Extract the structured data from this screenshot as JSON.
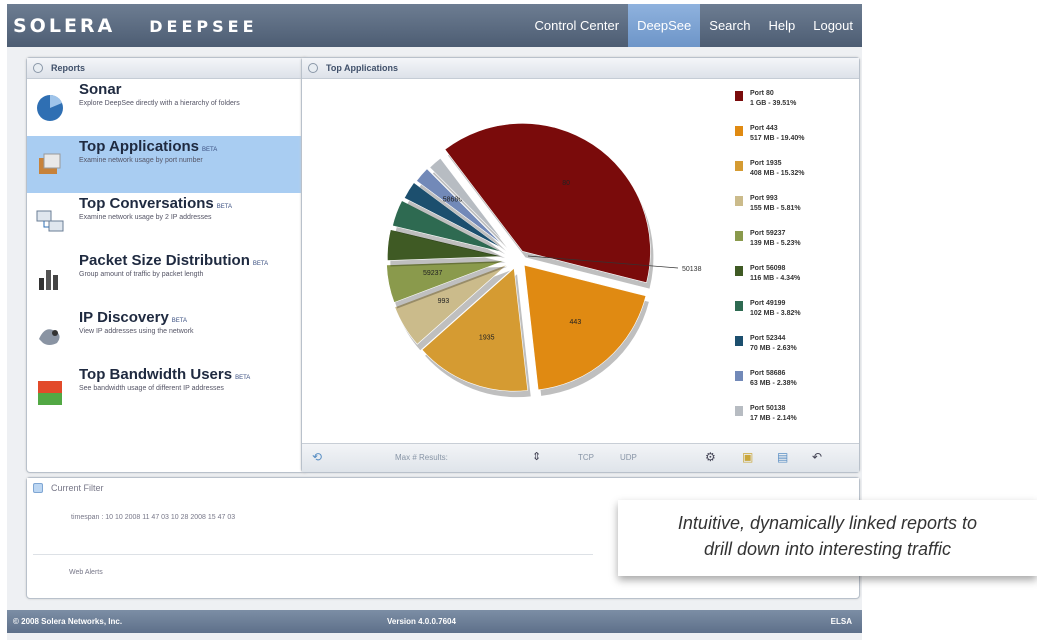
{
  "header": {
    "logo": "SOLERA",
    "product": "DEEPSEE",
    "nav": [
      "Control Center",
      "DeepSee",
      "Search",
      "Help",
      "Logout"
    ],
    "active_nav": "DeepSee"
  },
  "reports_panel": {
    "title": "Reports",
    "items": [
      {
        "title": "Sonar",
        "badge": "",
        "desc": "Explore DeepSee directly with a hierarchy of folders"
      },
      {
        "title": "Top Applications",
        "badge": "BETA",
        "desc": "Examine network usage by port number"
      },
      {
        "title": "Top Conversations",
        "badge": "BETA",
        "desc": "Examine network usage by 2 IP addresses"
      },
      {
        "title": "Packet Size Distribution",
        "badge": "BETA",
        "desc": "Group amount of traffic by packet length"
      },
      {
        "title": "IP Discovery",
        "badge": "BETA",
        "desc": "View IP addresses using the network"
      },
      {
        "title": "Top Bandwidth Users",
        "badge": "BETA",
        "desc": "See bandwidth usage of different IP addresses"
      }
    ],
    "selected_index": 1
  },
  "top_apps_panel": {
    "title": "Top Applications",
    "toolbar": {
      "max_results": "Max # Results:",
      "tcp": "TCP",
      "udp": "UDP"
    },
    "callout_label": "50138"
  },
  "chart_data": {
    "type": "pie",
    "legend_placement": "right",
    "slices": [
      {
        "name": "Port 80",
        "label": "1 GB - 39.51%",
        "value": 39.51,
        "color": "#7a0b0b",
        "pie_label": "80"
      },
      {
        "name": "Port 443",
        "label": "517 MB - 19.40%",
        "value": 19.4,
        "color": "#e08a12",
        "pie_label": "443"
      },
      {
        "name": "Port 1935",
        "label": "408 MB - 15.32%",
        "value": 15.32,
        "color": "#d59b32",
        "pie_label": "1935"
      },
      {
        "name": "Port 993",
        "label": "155 MB - 5.81%",
        "value": 5.81,
        "color": "#cbbb8b",
        "pie_label": "993"
      },
      {
        "name": "Port 59237",
        "label": "139 MB - 5.23%",
        "value": 5.23,
        "color": "#8a9a4c",
        "pie_label": "59237"
      },
      {
        "name": "Port 56098",
        "label": "116 MB - 4.34%",
        "value": 4.34,
        "color": "#3f5a24",
        "pie_label": ""
      },
      {
        "name": "Port 49199",
        "label": "102 MB - 3.82%",
        "value": 3.82,
        "color": "#2e6a51",
        "pie_label": ""
      },
      {
        "name": "Port 52344",
        "label": "70 MB - 2.63%",
        "value": 2.63,
        "color": "#1c4f6e",
        "pie_label": ""
      },
      {
        "name": "Port 58686",
        "label": "63 MB - 2.38%",
        "value": 2.38,
        "color": "#7289b8",
        "pie_label": "58686"
      },
      {
        "name": "Port 50138",
        "label": "17 MB - 2.14%",
        "value": 2.14,
        "color": "#b7bcc2",
        "pie_label": ""
      }
    ]
  },
  "filter_panel": {
    "title": "Current Filter",
    "timespan": "timespan : 10 10 2008 11 47 03 10 28 2008 15 47 03",
    "watchlist": "Web Alerts"
  },
  "footer": {
    "left": "© 2008 Solera Networks, Inc.",
    "center": "Version 4.0.0.7604",
    "right": "ELSA"
  },
  "callout": {
    "line1": "Intuitive, dynamically linked reports to",
    "line2": "drill down into interesting traffic"
  }
}
